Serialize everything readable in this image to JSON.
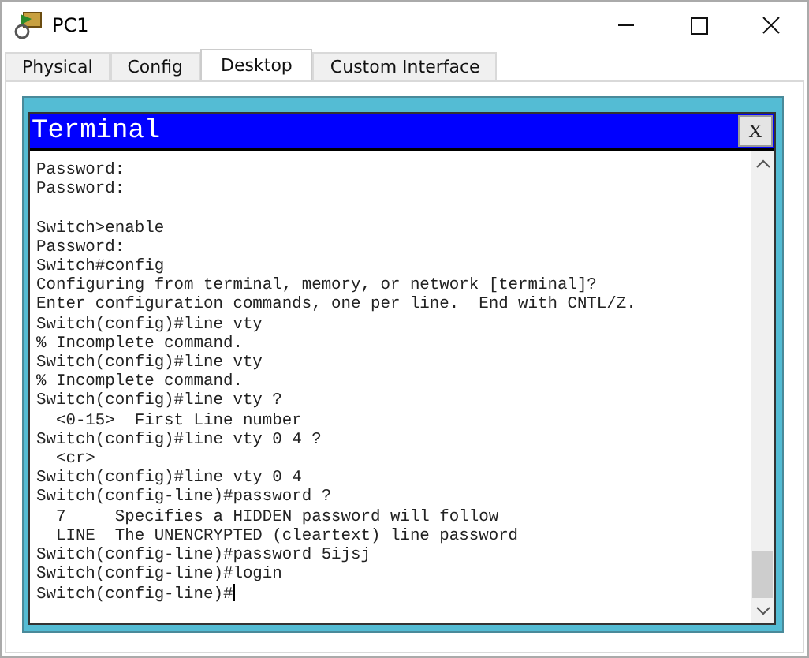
{
  "window": {
    "title": "PC1"
  },
  "tabs": [
    {
      "label": "Physical",
      "selected": false
    },
    {
      "label": "Config",
      "selected": false
    },
    {
      "label": "Desktop",
      "selected": true
    },
    {
      "label": "Custom Interface",
      "selected": false
    }
  ],
  "terminal": {
    "title": "Terminal",
    "close_label": "X",
    "blocks": [
      [
        "Password:",
        "Password:"
      ],
      [
        "Switch>enable",
        "Password:",
        "Switch#config",
        "Configuring from terminal, memory, or network [terminal]?",
        "Enter configuration commands, one per line.  End with CNTL/Z.",
        "Switch(config)#line vty",
        "% Incomplete command.",
        "Switch(config)#line vty",
        "% Incomplete command.",
        "Switch(config)#line vty ?",
        "  <0-15>  First Line number",
        "Switch(config)#line vty 0 4 ?",
        "  <cr>",
        "Switch(config)#line vty 0 4",
        "Switch(config-line)#password ?",
        "  7     Specifies a HIDDEN password will follow",
        "  LINE  The UNENCRYPTED (cleartext) line password",
        "Switch(config-line)#password 5ijsj",
        "Switch(config-line)#login",
        "Switch(config-line)#"
      ]
    ]
  }
}
